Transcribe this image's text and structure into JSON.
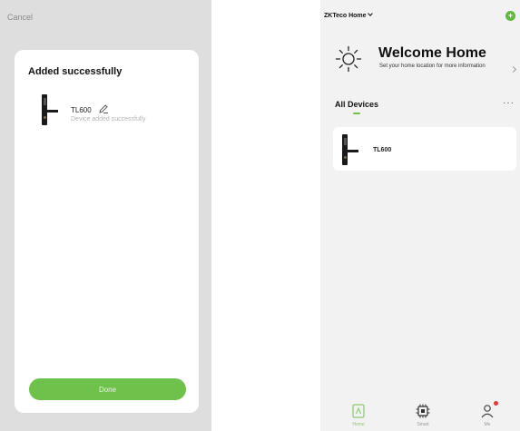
{
  "left": {
    "cancel_label": "Cancel",
    "title": "Added successfully",
    "device_name": "TL600",
    "status_message": "Device added successfully",
    "done_label": "Done"
  },
  "right": {
    "home_name": "ZKTeco Home",
    "welcome_title": "Welcome Home",
    "welcome_subtitle": "Set your home location for more information",
    "tab_all_devices": "All Devices",
    "more_label": "···",
    "add_label": "+",
    "device_name": "TL600",
    "bottom_tabs": [
      {
        "label": "Home",
        "icon": "home-icon",
        "active": true
      },
      {
        "label": "Smart",
        "icon": "smart-chip-icon",
        "active": false
      },
      {
        "label": "Me",
        "icon": "profile-icon",
        "active": false
      }
    ]
  },
  "colors": {
    "accent_green": "#6ec14a",
    "left_backdrop": "#dedede",
    "right_background": "#f2f2f2",
    "badge_red": "#e53935"
  }
}
